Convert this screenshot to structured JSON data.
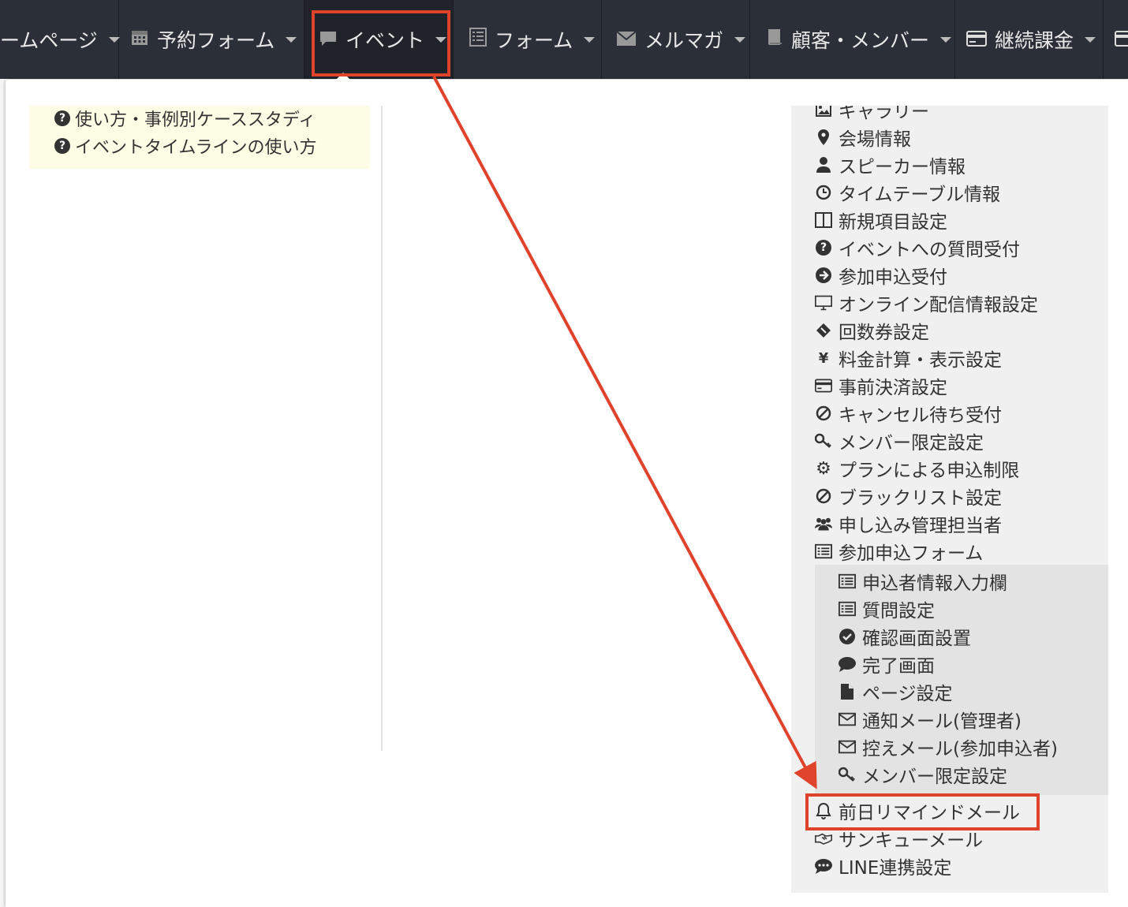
{
  "nav": {
    "items": [
      {
        "label": "ームページ",
        "icon": "",
        "active": false
      },
      {
        "label": "予約フォーム",
        "icon": "calendar-icon",
        "active": false
      },
      {
        "label": "イベント",
        "icon": "comment-icon",
        "active": true
      },
      {
        "label": "フォーム",
        "icon": "list-icon",
        "active": false
      },
      {
        "label": "メルマガ",
        "icon": "envelope-icon",
        "active": false
      },
      {
        "label": "顧客・メンバー",
        "icon": "book-icon",
        "active": false
      },
      {
        "label": "継続課金",
        "icon": "credit-card-icon",
        "active": false
      }
    ]
  },
  "help": {
    "items": [
      {
        "label": "使い方・事例別ケーススタディ",
        "icon": "question-circle-icon"
      },
      {
        "label": "イベントタイムラインの使い方",
        "icon": "question-circle-icon"
      }
    ]
  },
  "menu": {
    "items": [
      {
        "label": "ギャラリー",
        "icon": "image-icon"
      },
      {
        "label": "会場情報",
        "icon": "map-marker-icon"
      },
      {
        "label": "スピーカー情報",
        "icon": "user-icon"
      },
      {
        "label": "タイムテーブル情報",
        "icon": "clock-icon"
      },
      {
        "label": "新規項目設定",
        "icon": "columns-icon"
      },
      {
        "label": "イベントへの質問受付",
        "icon": "question-circle-icon"
      },
      {
        "label": "参加申込受付",
        "icon": "arrow-circle-right-icon"
      },
      {
        "label": "オンライン配信情報設定",
        "icon": "desktop-icon"
      },
      {
        "label": "回数券設定",
        "icon": "ticket-icon"
      },
      {
        "label": "料金計算・表示設定",
        "icon": "yen-icon"
      },
      {
        "label": "事前決済設定",
        "icon": "credit-card-icon"
      },
      {
        "label": "キャンセル待ち受付",
        "icon": "ban-icon"
      },
      {
        "label": "メンバー限定設定",
        "icon": "key-icon"
      },
      {
        "label": "プランによる申込制限",
        "icon": "gear-icon"
      },
      {
        "label": "ブラックリスト設定",
        "icon": "ban-icon"
      },
      {
        "label": "申し込み管理担当者",
        "icon": "users-icon"
      },
      {
        "label": "参加申込フォーム",
        "icon": "list-alt-icon"
      }
    ],
    "submenu": [
      {
        "label": "申込者情報入力欄",
        "icon": "list-alt-icon"
      },
      {
        "label": "質問設定",
        "icon": "list-alt-icon"
      },
      {
        "label": "確認画面設置",
        "icon": "check-circle-icon"
      },
      {
        "label": "完了画面",
        "icon": "comment-icon"
      },
      {
        "label": "ページ設定",
        "icon": "file-icon"
      },
      {
        "label": "通知メール(管理者)",
        "icon": "envelope-o-icon"
      },
      {
        "label": "控えメール(参加申込者)",
        "icon": "envelope-o-icon"
      },
      {
        "label": "メンバー限定設定",
        "icon": "key-icon"
      }
    ],
    "after": [
      {
        "label": "前日リマインドメール",
        "icon": "bell-icon",
        "highlighted": true
      },
      {
        "label": "サンキューメール",
        "icon": "handshake-icon"
      },
      {
        "label": "LINE連携設定",
        "icon": "comment-dots-icon"
      }
    ]
  },
  "annotation": {
    "color": "#e0432c"
  }
}
